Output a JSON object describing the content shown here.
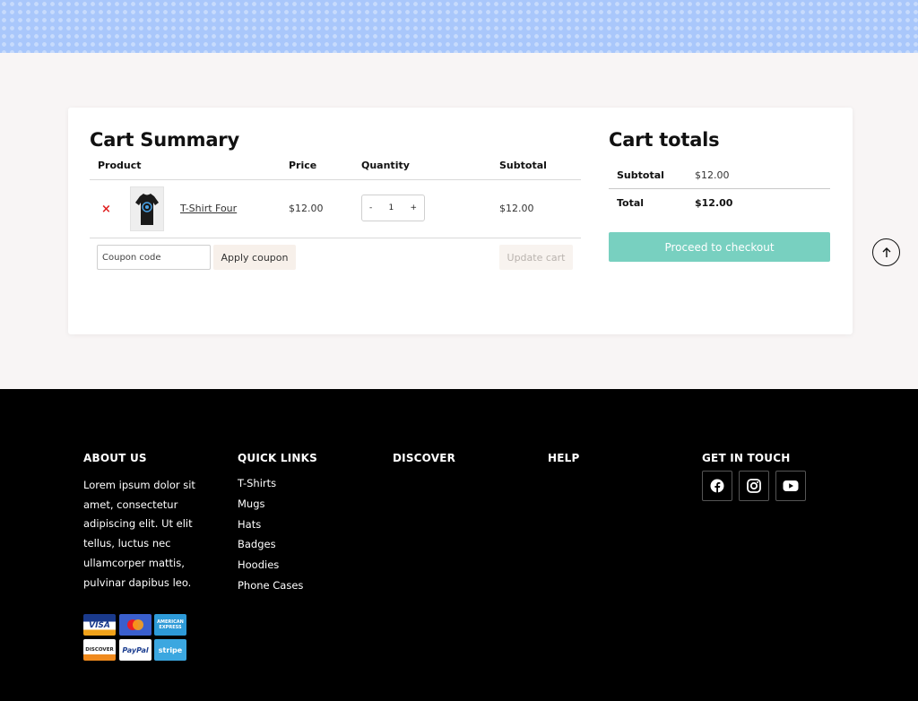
{
  "cart": {
    "title": "Cart Summary",
    "columns": [
      "Product",
      "Price",
      "Quantity",
      "Subtotal"
    ],
    "items": [
      {
        "remove_icon": "×",
        "name": "T-Shirt Four",
        "price": "$12.00",
        "quantity": "1",
        "subtotal": "$12.00",
        "qty_minus": "-",
        "qty_plus": "+"
      }
    ],
    "coupon_placeholder": "Coupon code",
    "apply_coupon_label": "Apply coupon",
    "update_cart_label": "Update cart"
  },
  "totals": {
    "title": "Cart totals",
    "subtotal_label": "Subtotal",
    "subtotal_value": "$12.00",
    "total_label": "Total",
    "total_value": "$12.00",
    "checkout_label": "Proceed to checkout"
  },
  "footer": {
    "about": {
      "heading": "ABOUT US",
      "text": "Lorem ipsum dolor sit amet, consectetur adipiscing elit. Ut elit tellus, luctus nec ullamcorper mattis, pulvinar dapibus leo."
    },
    "quick_links": {
      "heading": "QUICK LINKS",
      "items": [
        "T-Shirts",
        "Mugs",
        "Hats",
        "Badges",
        "Hoodies",
        "Phone Cases"
      ]
    },
    "discover": {
      "heading": "DISCOVER"
    },
    "help": {
      "heading": "HELP"
    },
    "contact": {
      "heading": "GET IN TOUCH",
      "social_icons": [
        "facebook-icon",
        "instagram-icon",
        "youtube-icon"
      ]
    },
    "payment_cards": [
      {
        "icon": "visa-card-icon",
        "label": "VISA"
      },
      {
        "icon": "mastercard-card-icon",
        "label": ""
      },
      {
        "icon": "amex-card-icon",
        "label": "AMERICAN EXPRESS"
      },
      {
        "icon": "discover-card-icon",
        "label": "DISCOVER"
      },
      {
        "icon": "paypal-card-icon",
        "label": "PayPal"
      },
      {
        "icon": "stripe-card-icon",
        "label": "stripe"
      }
    ]
  },
  "colors": {
    "hero_band": "#a9c7fb",
    "checkout_button": "#78d0c0",
    "remove_icon": "#e02020",
    "footer_bg": "#000000"
  }
}
